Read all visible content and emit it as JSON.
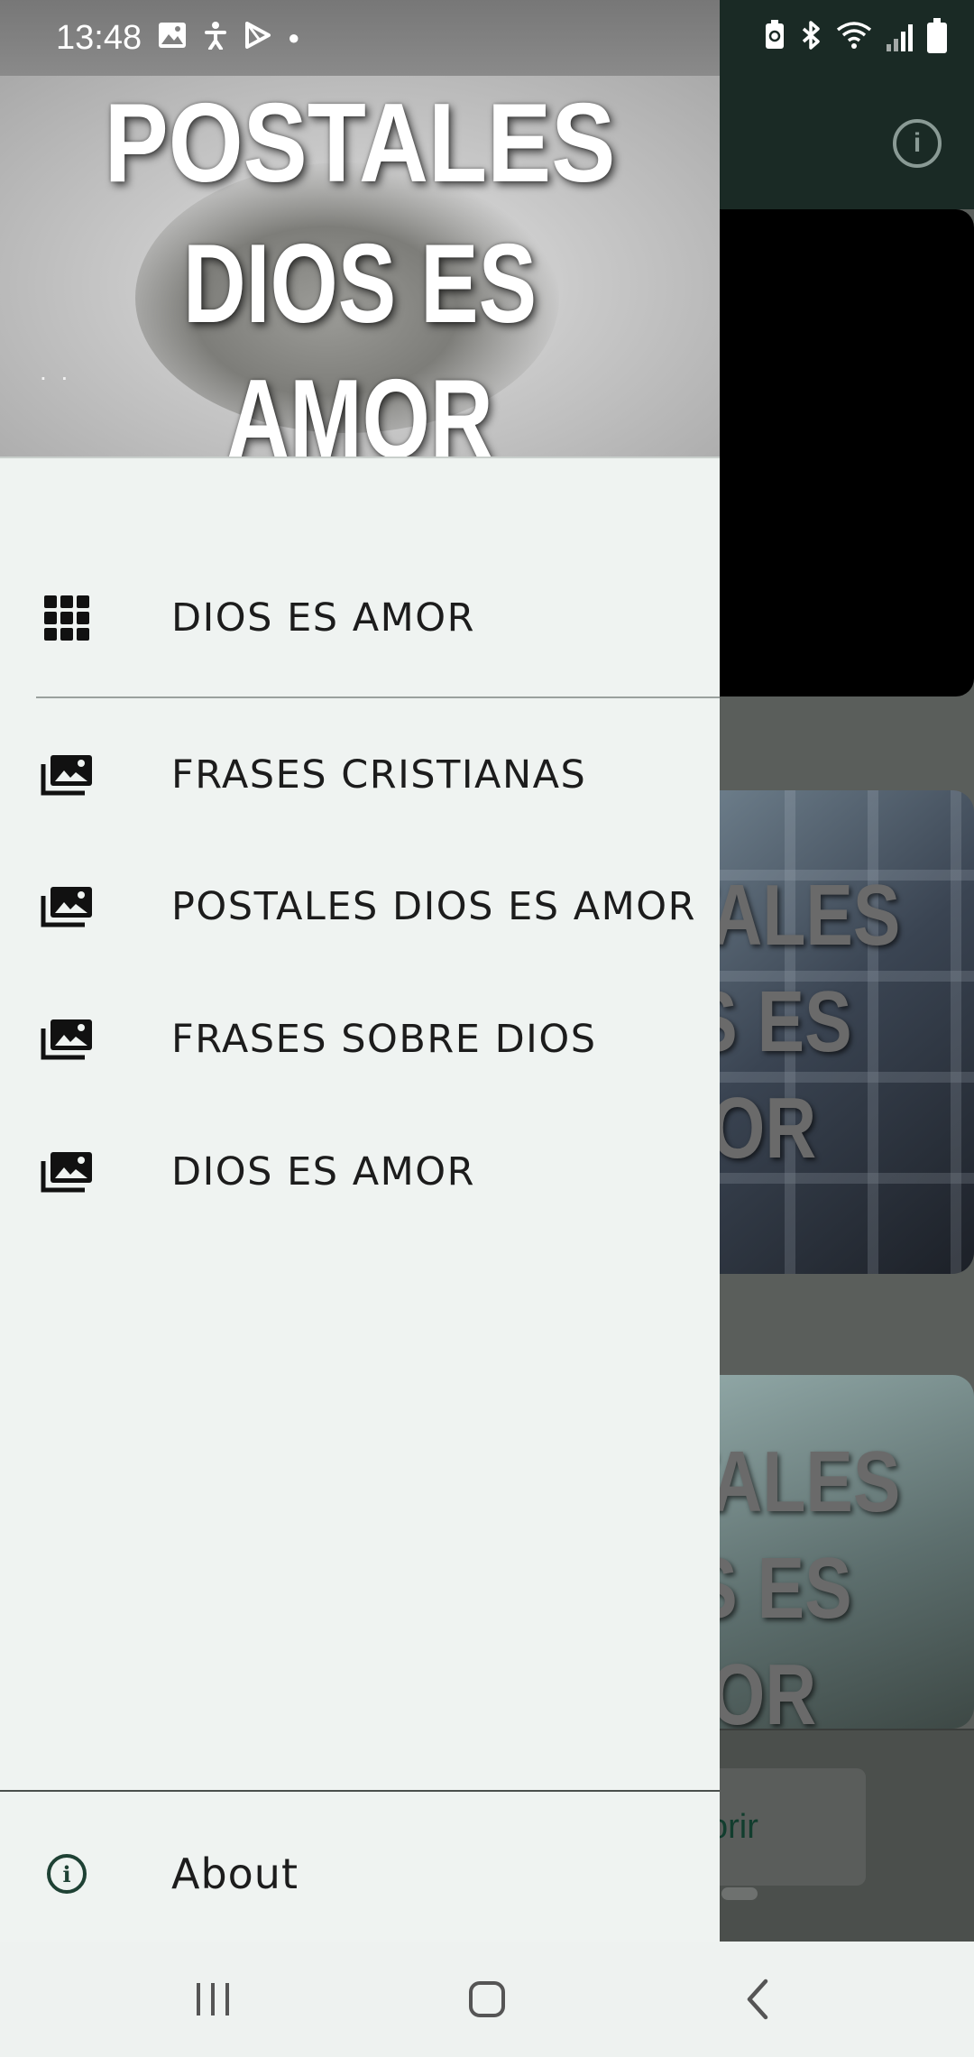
{
  "status_bar": {
    "time": "13:48",
    "icons": [
      "image-icon",
      "accessibility-icon",
      "play-store-icon",
      "dot-icon",
      "battery-saver-icon",
      "bluetooth-icon",
      "wifi-icon",
      "signal-icon",
      "battery-icon"
    ]
  },
  "drawer": {
    "header": {
      "title_line1": "POSTALES",
      "title_line2": "DIOS ES AMOR",
      "dots": ". ."
    },
    "primary_item": {
      "label": "DIOS ES AMOR",
      "icon": "apps-grid-icon"
    },
    "items": [
      {
        "label": "FRASES CRISTIANAS",
        "icon": "photo-library-icon"
      },
      {
        "label": "POSTALES DIOS ES AMOR",
        "icon": "photo-library-icon"
      },
      {
        "label": "FRASES SOBRE DIOS",
        "icon": "photo-library-icon"
      },
      {
        "label": "DIOS ES AMOR",
        "icon": "photo-library-icon"
      }
    ],
    "about": {
      "label": "About",
      "icon": "info-icon"
    }
  },
  "background": {
    "card1_text": "POSTALES\nDIOS ES\nAMOR",
    "card2_text": "POSTALES\nDIOS ES\nAMOR",
    "open_button_partial": "orir"
  },
  "colors": {
    "toolbar": "#1a2a25",
    "drawer_bg": "#eff3f1",
    "accent": "#1e4134"
  }
}
